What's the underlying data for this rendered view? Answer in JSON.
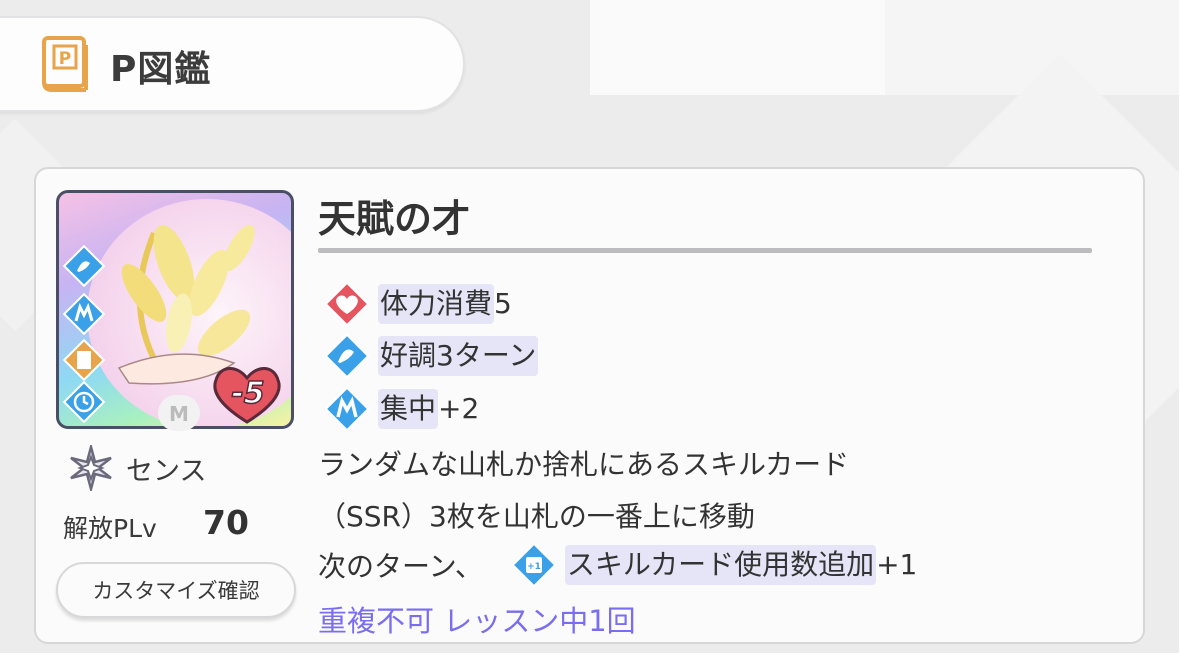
{
  "header": {
    "title": "P図鑑",
    "icon": "p-book-icon"
  },
  "skill": {
    "title": "天賦の才",
    "cost": "-5",
    "rarity_mark": "M",
    "type_label": "センス",
    "plv_label": "解放PLv",
    "plv_value": "70",
    "customize_label": "カスタマイズ確認"
  },
  "effects": [
    {
      "icon": "heart-icon",
      "label": "体力消費",
      "value": "5"
    },
    {
      "icon": "good-condition-icon",
      "label": "好調3ターン",
      "value": ""
    },
    {
      "icon": "concentration-icon",
      "label": "集中",
      "value": "+2"
    }
  ],
  "description": {
    "line1": "ランダムな山札か捨札にあるスキルカード",
    "line2": "（SSR）3枚を山札の一番上に移動",
    "line3_prefix": "次のターン、",
    "line3_tag": "スキルカード使用数追加",
    "line3_value": "+1"
  },
  "limit_text": "重複不可 レッスン中1回",
  "colors": {
    "accent_purple": "#7a6ef0",
    "tag_bg": "#e6e5f7",
    "heart_red": "#e5555f",
    "diamond_blue": "#3aa0e8",
    "book_orange": "#e8a44a"
  }
}
